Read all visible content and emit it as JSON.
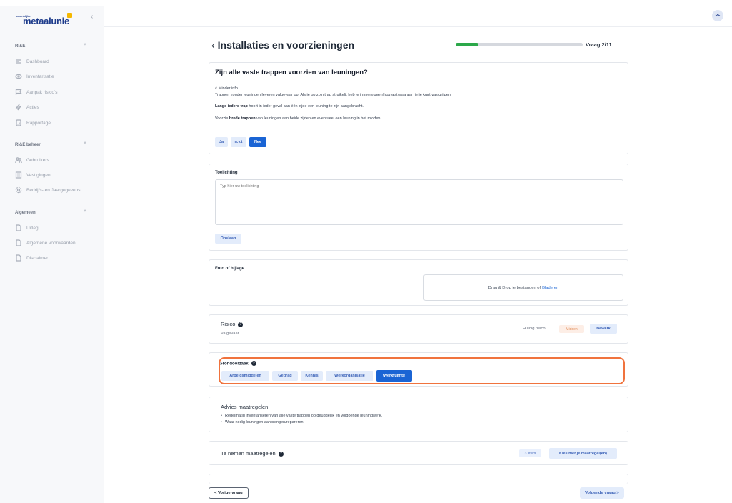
{
  "sidebar": {
    "logo_small": "koninklijke",
    "logo_big": "metaalunie",
    "collapse_icon": "chevron-left",
    "sections": [
      {
        "title": "RI&E",
        "items": [
          {
            "label": "Dashboard",
            "icon": "list-icon"
          },
          {
            "label": "Inventarisatie",
            "icon": "eye-icon"
          },
          {
            "label": "Aanpak risico's",
            "icon": "flag-icon"
          },
          {
            "label": "Acties",
            "icon": "bolt-icon"
          },
          {
            "label": "Rapportage",
            "icon": "report-icon"
          }
        ]
      },
      {
        "title": "RI&E beheer",
        "items": [
          {
            "label": "Gebruikers",
            "icon": "users-icon"
          },
          {
            "label": "Vestigingen",
            "icon": "building-icon"
          },
          {
            "label": "Bedrijfs- en Jaargegevens",
            "icon": "gear-icon"
          }
        ]
      },
      {
        "title": "Algemeen",
        "items": [
          {
            "label": "Uitleg",
            "icon": "file-icon"
          },
          {
            "label": "Algemene voorwaarden",
            "icon": "file-icon"
          },
          {
            "label": "Disclaimer",
            "icon": "file-icon"
          }
        ]
      }
    ]
  },
  "header": {
    "avatar": "RF"
  },
  "page": {
    "title": "Installaties en voorzieningen",
    "progress_fraction": 0.18,
    "vraag": "Vraag 2/11"
  },
  "question": {
    "title": "Zijn alle vaste trappen voorzien van leuningen?",
    "less_info": "< Minder info",
    "line1": "Trappen zonder leuningen leveren valgevaar op. Als je op zo'n trap struikelt, heb je immers geen houvast waaraan je je kunt vastgrijpen.",
    "line2_bold": "Langs iedere trap",
    "line2_rest": " hoort in ieder geval aan één zijde een leuning te zijn aangebracht.",
    "line3_start": "Voorzie ",
    "line3_bold": "brede trappen",
    "line3_rest": " van leuningen aan beide zijden en eventueel een leuning in het midden.",
    "answers": {
      "ja": "Ja",
      "nvt": "n.v.t",
      "nee": "Nee"
    }
  },
  "toelichting": {
    "label": "Toelichting",
    "placeholder": "Typ hier uw toelichting",
    "save": "Opslaan"
  },
  "bijlage": {
    "label": "Foto of bijlage",
    "drop_text": "Drag & Drop je bestanden of",
    "browse": "Bladeren"
  },
  "risico": {
    "title": "Risico",
    "subtitle": "Valgevaar",
    "current_label": "Huidig risico",
    "level": "Midden",
    "edit": "Bewerk"
  },
  "grondoorzaak": {
    "title": "Grondoorzaak",
    "options": {
      "arbeidsmiddelen": "Arbeidsmiddelen",
      "gedrag": "Gedrag",
      "kennis": "Kennis",
      "werkorganisatie": "Werkorganisatie",
      "werkruimte": "Werkruimte"
    }
  },
  "advies": {
    "title": "Advies maatregelen",
    "items": [
      "Regelmatig inventariseren van alle vaste trappen op deugdelijk en voldoende leuningwerk.",
      "Waar nodig leuningen aanbrengen/repareren."
    ]
  },
  "maatregelen": {
    "title": "Te nemen maatregelen",
    "count": "3 stuks",
    "choose": "Kies hier je maatregel(en)"
  },
  "footer": {
    "prev": "< Vorige vraag",
    "next": "Volgende vraag >"
  },
  "colors": {
    "brand": "#1d3b8b",
    "primary": "#1a64d4",
    "progress": "#2ca84a",
    "highlight": "#f0733e"
  }
}
